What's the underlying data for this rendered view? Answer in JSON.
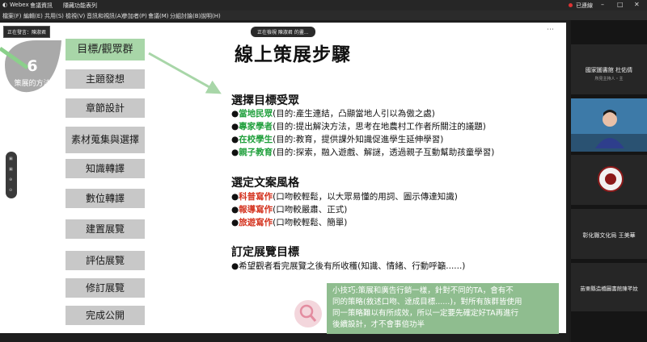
{
  "app": {
    "name": "Webex",
    "menu_labels": [
      "會議資訊",
      "隱藏功能表列"
    ],
    "status": "已連線"
  },
  "menubar": [
    "檔案(F)",
    "編輯(E)",
    "共用(S)",
    "檢視(V)",
    "音訊和視訊(A)",
    "參加者(P)",
    "會議(M)",
    "分組討論(B)",
    "說明(H)"
  ],
  "presenting_label": "正在發言：陳淑君",
  "viewing_label": "正在檢視 陳淑君 的畫...",
  "slide": {
    "step_number": "6",
    "step_label": "策展的方法",
    "title": "線上策展步驟",
    "menu": [
      "目標/觀眾群",
      "主題發想",
      "章節設計",
      "素材蒐集與選擇",
      "知識轉譯",
      "數位轉譯",
      "建置展覽",
      "評估展覽",
      "修訂展覽",
      "完成公開"
    ],
    "sections": [
      {
        "heading": "選擇目標受眾",
        "items": [
          {
            "kw": "當地民眾",
            "text": "(目的:產生連結，凸顯當地人引以為傲之處)"
          },
          {
            "kw": "專家學者",
            "text": "(目的:提出解決方法，思考在地農村工作者所關注的議題)"
          },
          {
            "kw": "在校學生",
            "text": "(目的:教育，提供課外知識促進學生延伸學習)"
          },
          {
            "kw": "親子教育",
            "text": "(目的:探索，融入遊戲、解謎，透過親子互動幫助孩童學習)"
          }
        ]
      },
      {
        "heading": "選定文案風格",
        "items": [
          {
            "kw": "科普寫作",
            "text": "(口吻較輕鬆，以大眾易懂的用詞、圖示傳達知識)"
          },
          {
            "kw": "報導寫作",
            "text": "(口吻較嚴肅、正式)"
          },
          {
            "kw": "旅遊寫作",
            "text": "(口吻較輕鬆、簡單)"
          }
        ]
      },
      {
        "heading": "訂定展覽目標",
        "items": [
          {
            "kw": "",
            "text": "希望觀者看完展覽之後有所收穫(知識、情緒、行動呼籲......)"
          }
        ]
      }
    ],
    "tip": [
      "小技巧:策展和廣告行銷一樣，針對不同的TA，會有不",
      "同的策略(敘述口吻、達成目標......)，對所有族群皆使用",
      "同一策略難以有所成效，所以一定要先確定好TA再進行",
      "後續設計，才不會事倍功半"
    ]
  },
  "participants": [
    {
      "name": "國家圖書館 杜佑倩",
      "sub": "所見主持人・主"
    },
    {
      "name": "",
      "sub": ""
    },
    {
      "name": "",
      "sub": ""
    },
    {
      "name": "彰化縣文化局 王美華",
      "sub": ""
    },
    {
      "name": "苗栗縣造橋圖書館陳芊妏",
      "sub": ""
    }
  ],
  "colors": {
    "accent_green": "#1f9f3b",
    "accent_red": "#d4331f",
    "menu_active": "#a8d6a8",
    "menu_inactive": "#c8c8c8",
    "tip_bg": "#8fbd8f"
  }
}
